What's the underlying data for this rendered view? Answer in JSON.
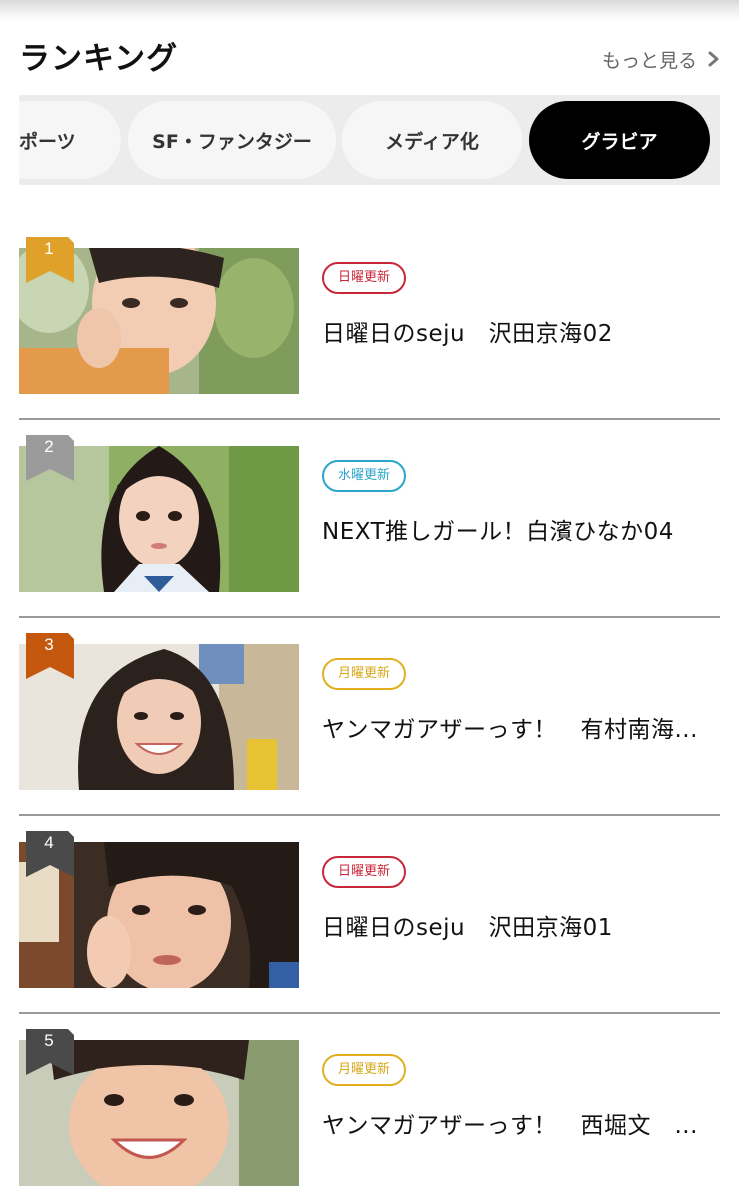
{
  "header": {
    "title": "ランキング",
    "more_label": "もっと見る"
  },
  "tabs": [
    {
      "label": "ポーツ",
      "active": false
    },
    {
      "label": "SF・ファンタジー",
      "active": false
    },
    {
      "label": "メディア化",
      "active": false
    },
    {
      "label": "グラビア",
      "active": true
    }
  ],
  "ranking": [
    {
      "rank": "1",
      "day_label": "日曜更新",
      "day_type": "sun",
      "title": "日曜日のseju　沢田京海02",
      "badge_color": "#e0a12a"
    },
    {
      "rank": "2",
      "day_label": "水曜更新",
      "day_type": "wed",
      "title": "NEXT推しガール！白濱ひなか04",
      "badge_color": "#9b9b9b"
    },
    {
      "rank": "3",
      "day_label": "月曜更新",
      "day_type": "mon",
      "title": "ヤンマガアザーっす！　有村南海...",
      "badge_color": "#c4580f"
    },
    {
      "rank": "4",
      "day_label": "日曜更新",
      "day_type": "sun",
      "title": "日曜日のseju　沢田京海01",
      "badge_color": "#4a4a4a"
    },
    {
      "rank": "5",
      "day_label": "月曜更新",
      "day_type": "mon",
      "title": "ヤンマガアザーっす！　西堀文　...",
      "badge_color": "#4a4a4a"
    }
  ],
  "colors": {
    "active_tab_bg": "#000000",
    "tab_bg": "#f6f6f6",
    "tab_strip_bg": "#ececec"
  }
}
